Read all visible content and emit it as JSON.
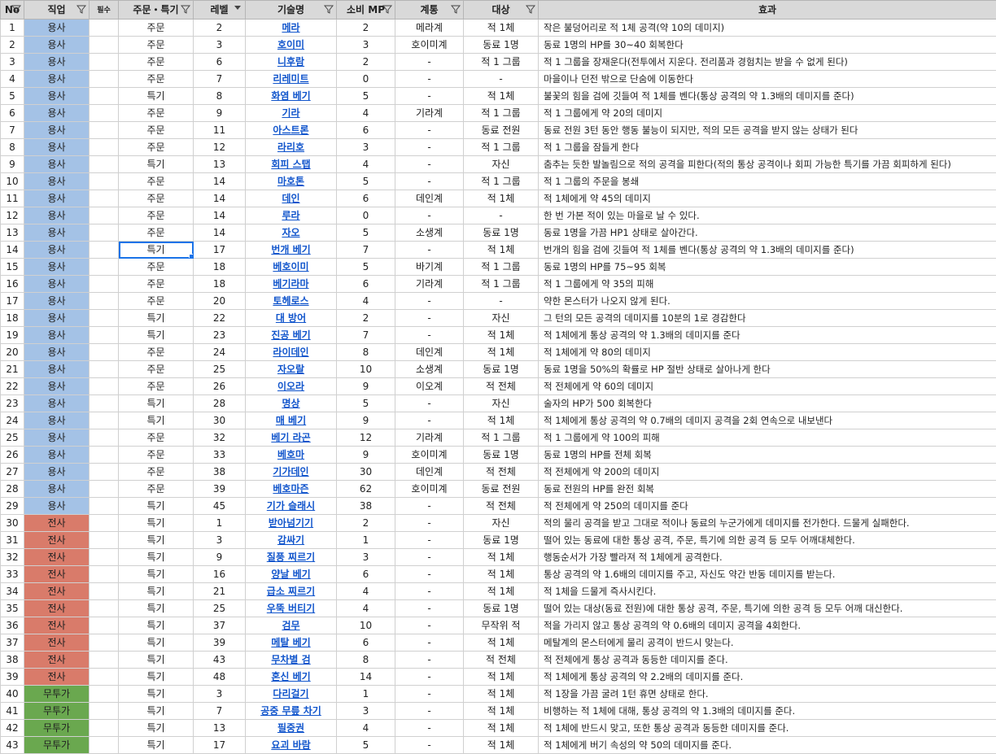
{
  "colors": {
    "header_bg": "#d9d9d9",
    "hero": "#a4c2e6",
    "warrior": "#d97b6a",
    "martial_artist": "#6aa84f",
    "link": "#1155cc",
    "selection": "#1a73e8"
  },
  "headers": {
    "no": "No",
    "job": "직업",
    "req": "필수",
    "type": "주문・특기",
    "level": "레벨",
    "skill": "기술명",
    "mp": "소비 MP",
    "family": "계통",
    "target": "대상",
    "effect": "효과"
  },
  "rows": [
    {
      "no": "1",
      "job": "용사",
      "job_class": "hero",
      "type": "주문",
      "level": "2",
      "skill": "메라",
      "mp": "2",
      "family": "메라계",
      "target": "적 1체",
      "effect": "작은 불덩어리로 적 1체 공격(약 10의 데미지)"
    },
    {
      "no": "2",
      "job": "용사",
      "job_class": "hero",
      "type": "주문",
      "level": "3",
      "skill": "호이미",
      "mp": "3",
      "family": "호이미계",
      "target": "동료 1명",
      "effect": "동료 1명의 HP를 30~40 회복한다"
    },
    {
      "no": "3",
      "job": "용사",
      "job_class": "hero",
      "type": "주문",
      "level": "6",
      "skill": "니후람",
      "mp": "2",
      "family": "-",
      "target": "적 1 그룹",
      "effect": "적 1 그룹을 장재운다(전투에서 지운다. 전리품과 경험치는 받을 수 없게 된다)"
    },
    {
      "no": "4",
      "job": "용사",
      "job_class": "hero",
      "type": "주문",
      "level": "7",
      "skill": "리레미트",
      "mp": "0",
      "family": "-",
      "target": "-",
      "effect": "마을이나 던전 밖으로 단숨에 이동한다"
    },
    {
      "no": "5",
      "job": "용사",
      "job_class": "hero",
      "type": "특기",
      "level": "8",
      "skill": "화염 베기",
      "mp": "5",
      "family": "-",
      "target": "적 1체",
      "effect": "불꽃의 힘을 검에 깃들여 적 1체를 벤다(통상 공격의 약 1.3배의 데미지를 준다)"
    },
    {
      "no": "6",
      "job": "용사",
      "job_class": "hero",
      "type": "주문",
      "level": "9",
      "skill": "기라",
      "mp": "4",
      "family": "기라계",
      "target": "적 1 그룹",
      "effect": "적 1 그룹에게 약 20의 데미지"
    },
    {
      "no": "7",
      "job": "용사",
      "job_class": "hero",
      "type": "주문",
      "level": "11",
      "skill": "아스트론",
      "mp": "6",
      "family": "-",
      "target": "동료 전원",
      "effect": "동료 전원 3턴 동안 행동 불능이 되지만, 적의 모든 공격을 받지 않는 상태가 된다"
    },
    {
      "no": "8",
      "job": "용사",
      "job_class": "hero",
      "type": "주문",
      "level": "12",
      "skill": "라리호",
      "mp": "3",
      "family": "-",
      "target": "적 1 그룹",
      "effect": "적 1 그룹을 잠들게 한다"
    },
    {
      "no": "9",
      "job": "용사",
      "job_class": "hero",
      "type": "특기",
      "level": "13",
      "skill": "회피 스탭",
      "mp": "4",
      "family": "-",
      "target": "자신",
      "effect": "춤추는 듯한 발놀림으로 적의 공격을 피한다(적의 통상 공격이나 회피 가능한 특기를 가끔 회피하게 된다)"
    },
    {
      "no": "10",
      "job": "용사",
      "job_class": "hero",
      "type": "주문",
      "level": "14",
      "skill": "마호톤",
      "mp": "5",
      "family": "-",
      "target": "적 1 그룹",
      "effect": "적 1 그룹의 주문을 봉쇄"
    },
    {
      "no": "11",
      "job": "용사",
      "job_class": "hero",
      "type": "주문",
      "level": "14",
      "skill": "데인",
      "mp": "6",
      "family": "데인계",
      "target": "적 1체",
      "effect": "적 1체에게 약 45의 데미지"
    },
    {
      "no": "12",
      "job": "용사",
      "job_class": "hero",
      "type": "주문",
      "level": "14",
      "skill": "루라",
      "mp": "0",
      "family": "-",
      "target": "-",
      "effect": "한 번 가본 적이 있는 마을로 날 수 있다."
    },
    {
      "no": "13",
      "job": "용사",
      "job_class": "hero",
      "type": "주문",
      "level": "14",
      "skill": "자오",
      "mp": "5",
      "family": "소생계",
      "target": "동료 1명",
      "effect": "동료 1명을 가끔 HP1 상태로 살아간다."
    },
    {
      "no": "14",
      "job": "용사",
      "job_class": "hero",
      "type": "특기",
      "level": "17",
      "skill": "번개 베기",
      "mp": "7",
      "family": "-",
      "target": "적 1체",
      "effect": "번개의 힘을 검에 깃들여 적 1체를 벤다(통상 공격의 약 1.3배의 데미지를 준다)",
      "selected": true
    },
    {
      "no": "15",
      "job": "용사",
      "job_class": "hero",
      "type": "주문",
      "level": "18",
      "skill": "베호이미",
      "mp": "5",
      "family": "바기계",
      "target": "적 1 그룹",
      "effect": "동료 1명의 HP를 75~95 회복"
    },
    {
      "no": "16",
      "job": "용사",
      "job_class": "hero",
      "type": "주문",
      "level": "18",
      "skill": "베기라마",
      "mp": "6",
      "family": "기라계",
      "target": "적 1 그룹",
      "effect": "적 1 그룹에게 약 35의 피해"
    },
    {
      "no": "17",
      "job": "용사",
      "job_class": "hero",
      "type": "주문",
      "level": "20",
      "skill": "토헤로스",
      "mp": "4",
      "family": "-",
      "target": "-",
      "effect": "약한 몬스터가 나오지 않게 된다."
    },
    {
      "no": "18",
      "job": "용사",
      "job_class": "hero",
      "type": "특기",
      "level": "22",
      "skill": "대 방어",
      "mp": "2",
      "family": "-",
      "target": "자신",
      "effect": "그 턴의 모든 공격의 데미지를 10분의 1로 경감한다"
    },
    {
      "no": "19",
      "job": "용사",
      "job_class": "hero",
      "type": "특기",
      "level": "23",
      "skill": "진공 베기",
      "mp": "7",
      "family": "-",
      "target": "적 1체",
      "effect": "적 1체에게 통상 공격의 약 1.3배의 데미지를 준다"
    },
    {
      "no": "20",
      "job": "용사",
      "job_class": "hero",
      "type": "주문",
      "level": "24",
      "skill": "라이데인",
      "mp": "8",
      "family": "데인계",
      "target": "적 1체",
      "effect": "적 1체에게 약 80의 데미지"
    },
    {
      "no": "21",
      "job": "용사",
      "job_class": "hero",
      "type": "주문",
      "level": "25",
      "skill": "자오랄",
      "mp": "10",
      "family": "소생계",
      "target": "동료 1명",
      "effect": "동료 1명을 50%의 확률로 HP 절반 상태로 살아나게 한다"
    },
    {
      "no": "22",
      "job": "용사",
      "job_class": "hero",
      "type": "주문",
      "level": "26",
      "skill": "이오라",
      "mp": "9",
      "family": "이오계",
      "target": "적 전체",
      "effect": "적 전체에게 약 60의 데미지"
    },
    {
      "no": "23",
      "job": "용사",
      "job_class": "hero",
      "type": "특기",
      "level": "28",
      "skill": "명상",
      "mp": "5",
      "family": "-",
      "target": "자신",
      "effect": "술자의 HP가 500 회복한다"
    },
    {
      "no": "24",
      "job": "용사",
      "job_class": "hero",
      "type": "특기",
      "level": "30",
      "skill": "매 베기",
      "mp": "9",
      "family": "-",
      "target": "적 1체",
      "effect": "적 1체에게 통상 공격의 약 0.7배의 데미지 공격을 2회 연속으로 내보낸다"
    },
    {
      "no": "25",
      "job": "용사",
      "job_class": "hero",
      "type": "주문",
      "level": "32",
      "skill": "베기 라곤",
      "mp": "12",
      "family": "기라계",
      "target": "적 1 그룹",
      "effect": "적 1 그룹에게 약 100의 피해"
    },
    {
      "no": "26",
      "job": "용사",
      "job_class": "hero",
      "type": "주문",
      "level": "33",
      "skill": "베호마",
      "mp": "9",
      "family": "호이미계",
      "target": "동료 1명",
      "effect": "동료 1명의 HP를 전체 회복"
    },
    {
      "no": "27",
      "job": "용사",
      "job_class": "hero",
      "type": "주문",
      "level": "38",
      "skill": "기가데인",
      "mp": "30",
      "family": "데인계",
      "target": "적 전체",
      "effect": "적 전체에게 약 200의 데미지"
    },
    {
      "no": "28",
      "job": "용사",
      "job_class": "hero",
      "type": "주문",
      "level": "39",
      "skill": "베호마즌",
      "mp": "62",
      "family": "호이미계",
      "target": "동료 전원",
      "effect": "동료 전원의 HP를 완전 회복"
    },
    {
      "no": "29",
      "job": "용사",
      "job_class": "hero",
      "type": "특기",
      "level": "45",
      "skill": "기가 슬래시",
      "mp": "38",
      "family": "-",
      "target": "적 전체",
      "effect": "적 전체에게 약 250의 데미지를 준다"
    },
    {
      "no": "30",
      "job": "전사",
      "job_class": "warrior",
      "type": "특기",
      "level": "1",
      "skill": "받아넘기기",
      "mp": "2",
      "family": "-",
      "target": "자신",
      "effect": "적의 물리 공격을 받고 그대로 적이나 동료의 누군가에게 데미지를 전가한다. 드물게 실패한다."
    },
    {
      "no": "31",
      "job": "전사",
      "job_class": "warrior",
      "type": "특기",
      "level": "3",
      "skill": "감싸기",
      "mp": "1",
      "family": "-",
      "target": "동료 1명",
      "effect": "떨어 있는 동료에 대한 통상 공격, 주문, 특기에 의한 공격 등 모두 어깨대체한다."
    },
    {
      "no": "32",
      "job": "전사",
      "job_class": "warrior",
      "type": "특기",
      "level": "9",
      "skill": "질풍 찌르기",
      "mp": "3",
      "family": "-",
      "target": "적 1체",
      "effect": "행동순서가 가장 빨라져 적 1체에게 공격한다."
    },
    {
      "no": "33",
      "job": "전사",
      "job_class": "warrior",
      "type": "특기",
      "level": "16",
      "skill": "양날 베기",
      "mp": "6",
      "family": "-",
      "target": "적 1체",
      "effect": "통상 공격의 약 1.6배의 데미지를 주고, 자신도 약간 반동 데미지를 받는다."
    },
    {
      "no": "34",
      "job": "전사",
      "job_class": "warrior",
      "type": "특기",
      "level": "21",
      "skill": "급소 찌르기",
      "mp": "4",
      "family": "-",
      "target": "적 1체",
      "effect": "적 1체을 드물게 즉사시킨다."
    },
    {
      "no": "35",
      "job": "전사",
      "job_class": "warrior",
      "type": "특기",
      "level": "25",
      "skill": "우뚝 버티기",
      "mp": "4",
      "family": "-",
      "target": "동료 1명",
      "effect": "떨어 있는 대상(동료 전원)에 대한 통상 공격, 주문, 특기에 의한 공격 등 모두 어깨 대신한다."
    },
    {
      "no": "36",
      "job": "전사",
      "job_class": "warrior",
      "type": "특기",
      "level": "37",
      "skill": "검무",
      "mp": "10",
      "family": "-",
      "target": "무작위 적",
      "effect": "적을 가리지 않고 통상 공격의 약 0.6배의 데미지 공격을 4회한다."
    },
    {
      "no": "37",
      "job": "전사",
      "job_class": "warrior",
      "type": "특기",
      "level": "39",
      "skill": "메탈 베기",
      "mp": "6",
      "family": "-",
      "target": "적 1체",
      "effect": "메탈계의 몬스터에게 물리 공격이 반드시 맞는다."
    },
    {
      "no": "38",
      "job": "전사",
      "job_class": "warrior",
      "type": "특기",
      "level": "43",
      "skill": "무차별 검",
      "mp": "8",
      "family": "-",
      "target": "적 전체",
      "effect": "적 전체에게 통상 공격과 동등한 데미지를 준다."
    },
    {
      "no": "39",
      "job": "전사",
      "job_class": "warrior",
      "type": "특기",
      "level": "48",
      "skill": "혼신 베기",
      "mp": "14",
      "family": "-",
      "target": "적 1체",
      "effect": "적 1체에게 통상 공격의 약 2.2배의 데미지를 준다."
    },
    {
      "no": "40",
      "job": "무투가",
      "job_class": "martial",
      "type": "특기",
      "level": "3",
      "skill": "다리걸기",
      "mp": "1",
      "family": "-",
      "target": "적 1체",
      "effect": "적 1장을 가끔 굴려 1턴 휴면 상태로 한다."
    },
    {
      "no": "41",
      "job": "무투가",
      "job_class": "martial",
      "type": "특기",
      "level": "7",
      "skill": "공중 무릎 차기",
      "mp": "3",
      "family": "-",
      "target": "적 1체",
      "effect": "비행하는 적 1체에 대해, 통상 공격의 약 1.3배의 데미지를 준다."
    },
    {
      "no": "42",
      "job": "무투가",
      "job_class": "martial",
      "type": "특기",
      "level": "13",
      "skill": "필중권",
      "mp": "4",
      "family": "-",
      "target": "적 1체",
      "effect": "적 1체에 반드시 맞고, 또한 통상 공격과 동등한 데미지를 준다."
    },
    {
      "no": "43",
      "job": "무투가",
      "job_class": "martial",
      "type": "특기",
      "level": "17",
      "skill": "요괴 바람",
      "mp": "5",
      "family": "-",
      "target": "적 1체",
      "effect": "적 1체에게 버기 속성의 약 50의 데미지를 준다."
    }
  ]
}
